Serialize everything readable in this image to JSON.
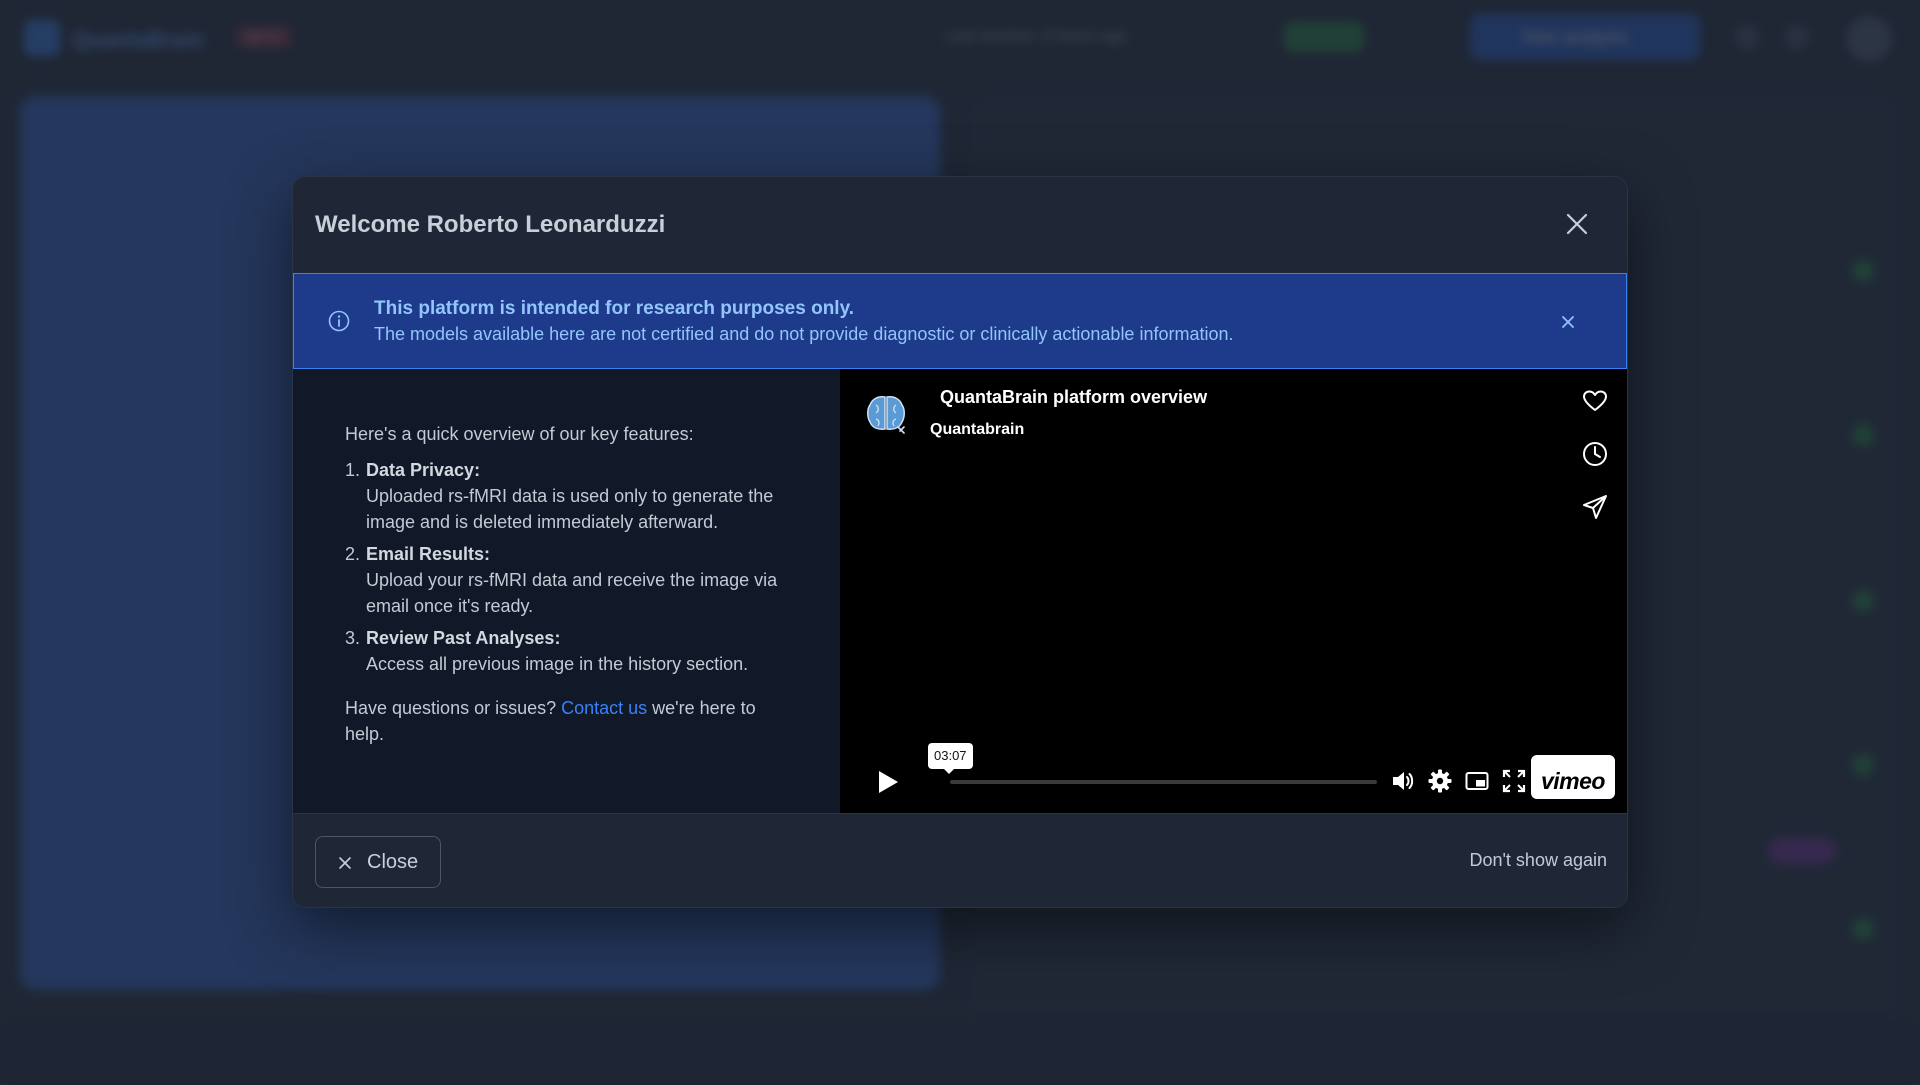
{
  "background_app": {
    "brand": "QuantaBrain",
    "beta_badge": "BETA",
    "last_session": "Last session: 6 hours ago",
    "new_analysis_label": "New analysis"
  },
  "modal": {
    "title": "Welcome Roberto Leonarduzzi",
    "alert": {
      "title": "This platform is intended for research purposes only.",
      "body": "The models available here are not certified and do not provide diagnostic or clinically actionable information."
    },
    "intro": "Here's a quick overview of our key features:",
    "features": [
      {
        "number": "1.",
        "title": "Data Privacy:",
        "description": "Uploaded rs-fMRI data is used only to generate the image and is deleted immediately afterward."
      },
      {
        "number": "2.",
        "title": "Email Results:",
        "description": "Upload your rs-fMRI data and receive the image via email once it's ready."
      },
      {
        "number": "3.",
        "title": "Review Past Analyses:",
        "description": "Access all previous image in the history section."
      }
    ],
    "help": {
      "prefix": "Have questions or issues? ",
      "link": "Contact us",
      "suffix": " we're here to help."
    },
    "video": {
      "title": "QuantaBrain platform overview",
      "channel": "Quantabrain",
      "duration": "03:07",
      "provider": "vimeo",
      "progress": 0
    },
    "footer": {
      "close_label": "Close",
      "dont_show_label": "Don't show again"
    }
  },
  "colors": {
    "accent": "#3b82f6",
    "alert_bg": "#1e3a8a",
    "modal_bg": "#111827",
    "header_bg": "#1f2736"
  },
  "icons": {
    "modal_close": "close-icon",
    "alert": "info-icon",
    "like": "heart-icon",
    "watch_later": "clock-icon",
    "share": "send-icon",
    "play": "play-icon",
    "volume": "volume-icon",
    "settings": "gear-icon",
    "pip": "picture-in-picture-icon",
    "fullscreen": "fullscreen-icon"
  }
}
